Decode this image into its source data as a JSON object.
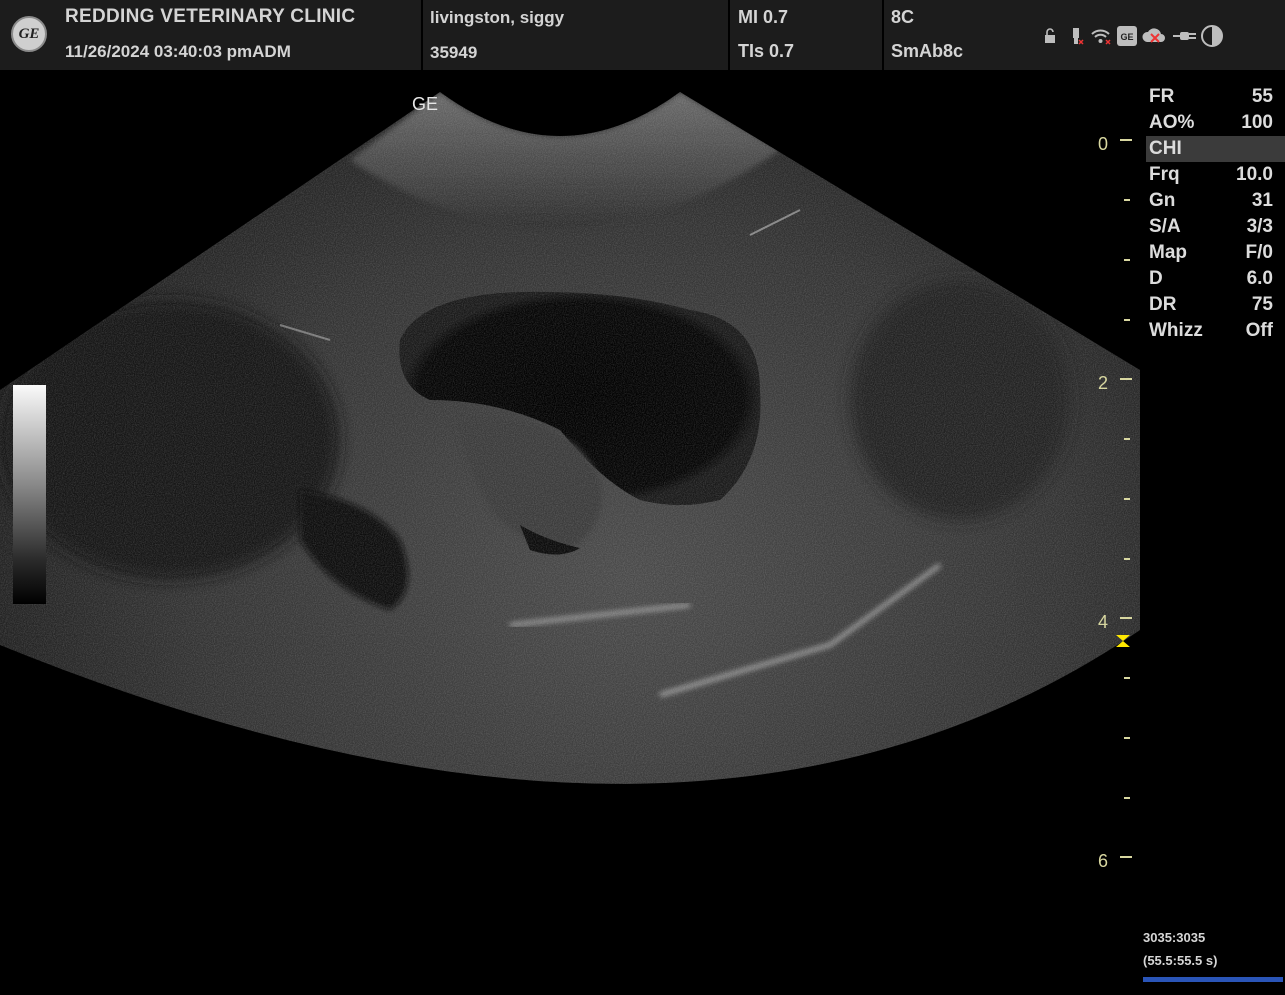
{
  "header": {
    "logo_text": "GE",
    "clinic": "REDDING VETERINARY CLINIC",
    "datetime": "11/26/2024  03:40:03 pmADM",
    "patient_name": "livingston, siggy",
    "patient_id": "35949",
    "mi": "MI 0.7",
    "tis": "TIs 0.7",
    "probe": "8C",
    "preset": "SmAb8c",
    "status_icons": [
      "lock-icon",
      "usb-icon",
      "wifi-icon",
      "ge-service-icon",
      "cloud-offline-icon",
      "power-plug-icon",
      "contrast-icon"
    ]
  },
  "image": {
    "orientation_mark": "GE",
    "depth_labels": [
      "0",
      "2",
      "4",
      "6"
    ],
    "focus_marker": "⧗"
  },
  "parameters": [
    {
      "key": "FR",
      "value": "55"
    },
    {
      "key": "AO%",
      "value": "100"
    },
    {
      "key": "CHI",
      "value": ""
    },
    {
      "key": "Frq",
      "value": "10.0"
    },
    {
      "key": "Gn",
      "value": "31"
    },
    {
      "key": "S/A",
      "value": "3/3"
    },
    {
      "key": "Map",
      "value": "F/0"
    },
    {
      "key": "D",
      "value": "6.0"
    },
    {
      "key": "DR",
      "value": "75"
    },
    {
      "key": "Whizz",
      "value": "Off"
    }
  ],
  "cine": {
    "frame_count": "3035:3035",
    "time": "(55.5:55.5 s)"
  },
  "colors": {
    "depth_scale": "#d8d7a0",
    "focus_marker": "#ffe800",
    "cine_bar": "#2a55b8"
  }
}
